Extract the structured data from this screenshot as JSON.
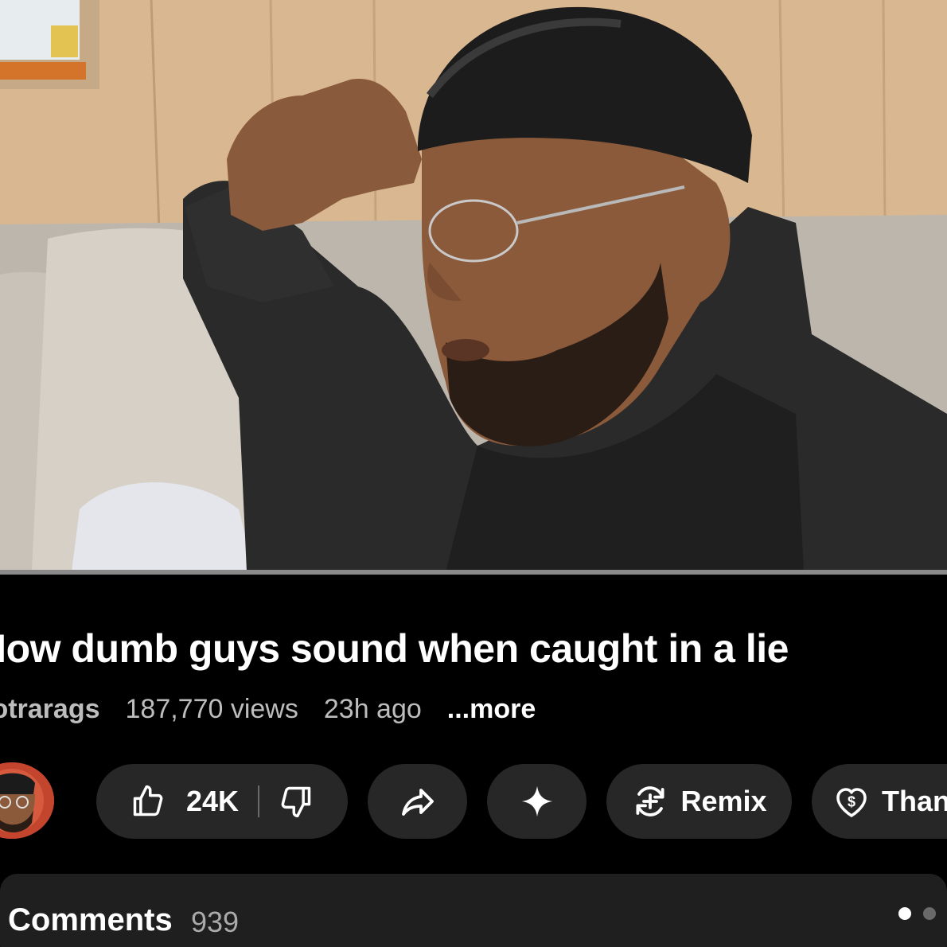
{
  "video": {
    "progress": 1.0
  },
  "title": "How dumb guys sound when caught in a lie",
  "meta": {
    "channel": "lotrarags",
    "views": "187,770 views",
    "age": "23h ago",
    "more": "...more"
  },
  "actions": {
    "like_icon": "thumbs-up-icon",
    "like_count": "24K",
    "dislike_icon": "thumbs-down-icon",
    "share_icon": "share-icon",
    "ask_icon": "sparkle-icon",
    "remix_icon": "remix-icon",
    "remix_label": "Remix",
    "thanks_icon": "heart-dollar-icon",
    "thanks_label": "Thanks"
  },
  "comments": {
    "title": "Comments",
    "count": "939"
  },
  "colors": {
    "background": "#000000",
    "pill": "#272727",
    "secondary_text": "#bdbdbd"
  }
}
